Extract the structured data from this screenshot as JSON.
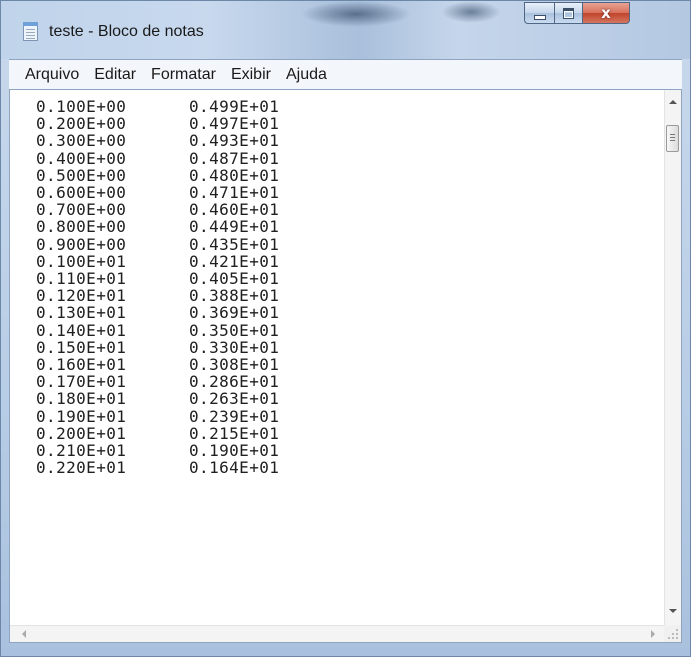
{
  "window": {
    "title": "teste - Bloco de notas",
    "close_glyph": "x"
  },
  "menu": {
    "items": [
      "Arquivo",
      "Editar",
      "Formatar",
      "Exibir",
      "Ajuda"
    ]
  },
  "editor": {
    "lines": [
      [
        "0.100E+00",
        "0.499E+01"
      ],
      [
        "0.200E+00",
        "0.497E+01"
      ],
      [
        "0.300E+00",
        "0.493E+01"
      ],
      [
        "0.400E+00",
        "0.487E+01"
      ],
      [
        "0.500E+00",
        "0.480E+01"
      ],
      [
        "0.600E+00",
        "0.471E+01"
      ],
      [
        "0.700E+00",
        "0.460E+01"
      ],
      [
        "0.800E+00",
        "0.449E+01"
      ],
      [
        "0.900E+00",
        "0.435E+01"
      ],
      [
        "0.100E+01",
        "0.421E+01"
      ],
      [
        "0.110E+01",
        "0.405E+01"
      ],
      [
        "0.120E+01",
        "0.388E+01"
      ],
      [
        "0.130E+01",
        "0.369E+01"
      ],
      [
        "0.140E+01",
        "0.350E+01"
      ],
      [
        "0.150E+01",
        "0.330E+01"
      ],
      [
        "0.160E+01",
        "0.308E+01"
      ],
      [
        "0.170E+01",
        "0.286E+01"
      ],
      [
        "0.180E+01",
        "0.263E+01"
      ],
      [
        "0.190E+01",
        "0.239E+01"
      ],
      [
        "0.200E+01",
        "0.215E+01"
      ],
      [
        "0.210E+01",
        "0.190E+01"
      ],
      [
        "0.220E+01",
        "0.164E+01"
      ]
    ]
  },
  "icons": {
    "app": "notepad-icon",
    "minimize": "minimize-icon",
    "maximize": "maximize-icon",
    "close": "close-icon"
  }
}
